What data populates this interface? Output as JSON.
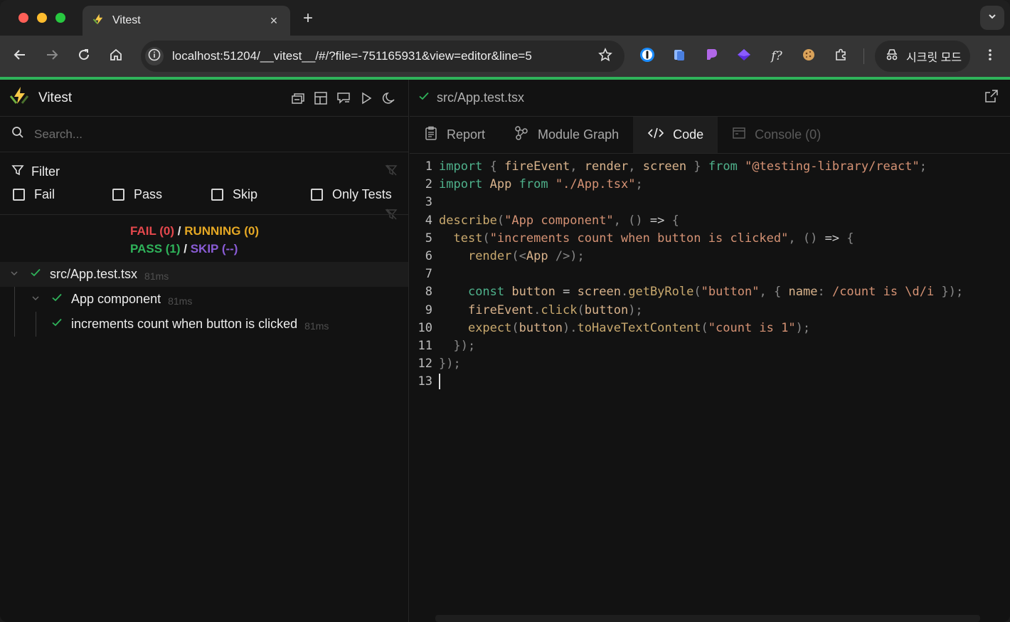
{
  "browser": {
    "tab_title": "Vitest",
    "tab_close": "×",
    "new_tab": "+",
    "url": "localhost:51204/__vitest__/#/?file=-751165931&view=editor&line=5",
    "incognito_label": "시크릿 모드",
    "colors": {
      "progress": "#2fb35a",
      "close": "#ff5f57",
      "minimize": "#febc2e",
      "zoom": "#28c840"
    }
  },
  "app": {
    "name": "Vitest",
    "search_placeholder": "Search...",
    "filter_title": "Filter",
    "filters": [
      "Fail",
      "Pass",
      "Skip",
      "Only Tests"
    ],
    "summary": {
      "fail": "FAIL (0)",
      "sep1": " / ",
      "running": "RUNNING (0)",
      "pass": "PASS (1)",
      "sep2": " / ",
      "skip": "SKIP (--)"
    },
    "tree": [
      {
        "name": "src/App.test.tsx",
        "duration": "81ms"
      },
      {
        "name": "App component",
        "duration": "81ms"
      },
      {
        "name": "increments count when button is clicked",
        "duration": "81ms"
      }
    ]
  },
  "viewer": {
    "file": "src/App.test.tsx",
    "tabs": [
      "Report",
      "Module Graph",
      "Code",
      "Console (0)"
    ],
    "active_tab": "Code",
    "line_numbers": [
      "1",
      "2",
      "3",
      "4",
      "5",
      "6",
      "7",
      "8",
      "9",
      "10",
      "11",
      "12",
      "13"
    ]
  }
}
